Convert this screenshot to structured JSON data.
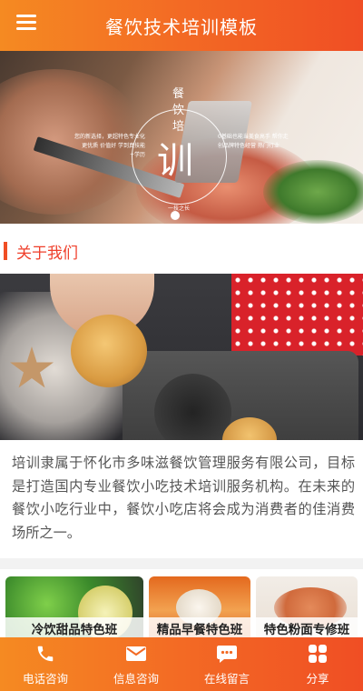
{
  "header": {
    "title": "餐饮技术培训模板",
    "menu_icon": "menu-icon"
  },
  "banner": {
    "logo_char_1": "餐",
    "logo_char_2": "饮",
    "logo_char_3": "培",
    "logo_big_char": "训",
    "logo_small_text": "一技之长",
    "left_text": "您的新选择，更超特色专业化 更优质 价值好 学到真技能+学历",
    "right_text": "0基础也能当美食高手 帮你走创品牌特色经营 热门行业",
    "active_slide": 1,
    "slide_count": 1
  },
  "about": {
    "title": "关于我们",
    "text": "培训隶属于怀化市多味滋餐饮管理服务有限公司，目标是打造国内专业餐饮小吃技术培训服务机构。在未来的餐饮小吃行业中，餐饮小吃店将会成为消费者的佳消费场所之一。"
  },
  "courses": [
    {
      "label": "冷饮甜品特色班"
    },
    {
      "label": "精品早餐特色班"
    },
    {
      "label": "特色粉面专修班"
    }
  ],
  "bottom_nav": [
    {
      "label": "电话咨询",
      "icon": "phone-icon"
    },
    {
      "label": "信息咨询",
      "icon": "mail-icon"
    },
    {
      "label": "在线留言",
      "icon": "chat-icon"
    },
    {
      "label": "分享",
      "icon": "share-icon"
    }
  ],
  "colors": {
    "accent_start": "#f58a22",
    "accent_end": "#f04e24",
    "section_title": "#ef3f2b"
  }
}
